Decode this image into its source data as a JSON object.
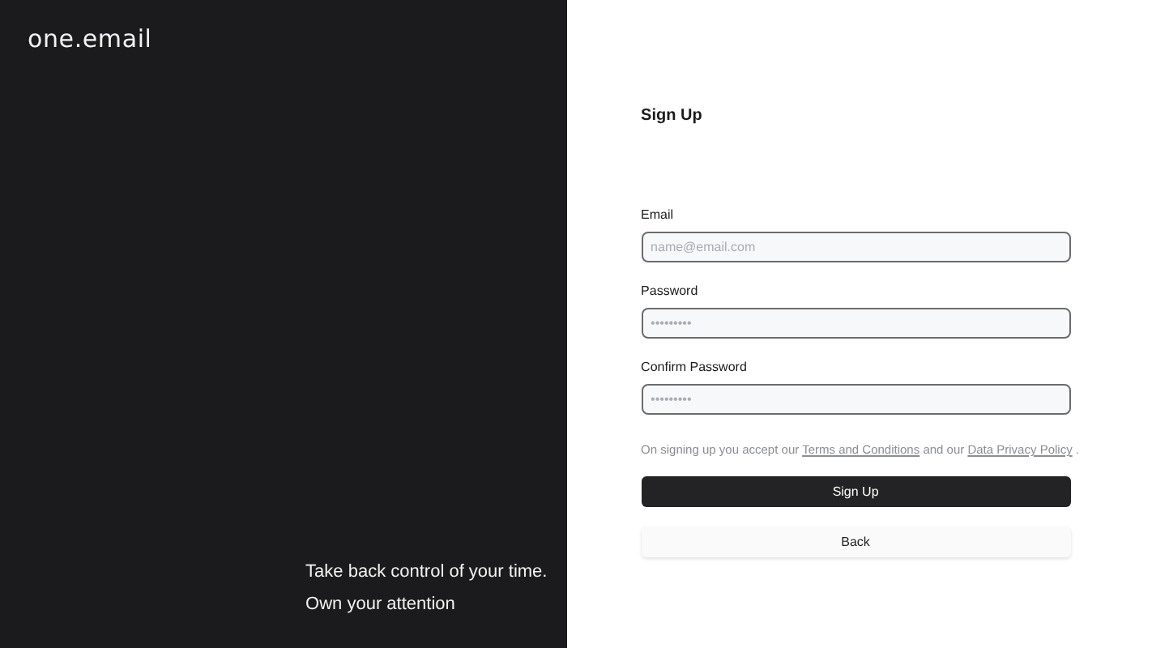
{
  "brand": {
    "logo": "one.email",
    "tagline": [
      "Take back control of your time.",
      "Own your attention"
    ]
  },
  "form": {
    "title": "Sign Up",
    "fields": [
      {
        "label": "Email",
        "placeholder": "name@email.com"
      },
      {
        "label": "Password",
        "placeholder": "•••••••••"
      },
      {
        "label": "Confirm Password",
        "placeholder": "•••••••••"
      }
    ],
    "consent": {
      "before": "On signing up you accept our",
      "terms_link": "Terms and Conditions",
      "middle": "and our",
      "privacy_link": "Data Privacy Policy",
      "after": "."
    },
    "buttons": [
      {
        "label": "Sign Up",
        "kind": "primary"
      },
      {
        "label": "Back",
        "kind": "secondary"
      }
    ]
  }
}
